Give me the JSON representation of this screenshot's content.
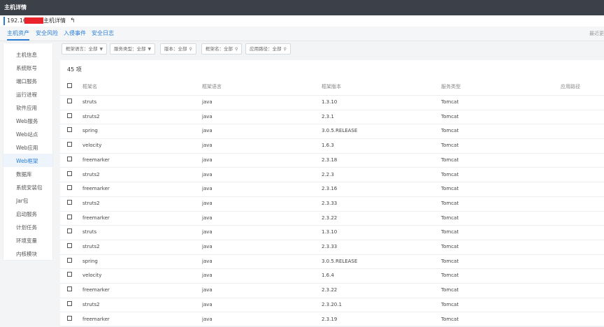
{
  "topbar": {
    "title": "主机详情"
  },
  "subheader": {
    "ip_prefix": "192.168",
    "host_label": "主机详情",
    "back_icon": "↰"
  },
  "tabs": [
    {
      "label": "主机资产",
      "active": true
    },
    {
      "label": "安全风险",
      "active": false
    },
    {
      "label": "入侵事件",
      "active": false
    },
    {
      "label": "安全日志",
      "active": false
    }
  ],
  "tabs_right_note": "最近更",
  "sidebar": {
    "items": [
      {
        "label": "主机信息"
      },
      {
        "label": "系统账号"
      },
      {
        "label": "端口服务"
      },
      {
        "label": "运行进程"
      },
      {
        "label": "软件应用"
      },
      {
        "label": "Web服务"
      },
      {
        "label": "Web站点"
      },
      {
        "label": "Web应用"
      },
      {
        "label": "Web框架",
        "active": true
      },
      {
        "label": "数据库"
      },
      {
        "label": "系统安装包"
      },
      {
        "label": "Jar包"
      },
      {
        "label": "启动服务"
      },
      {
        "label": "计划任务"
      },
      {
        "label": "环境变量"
      },
      {
        "label": "内核模块"
      }
    ]
  },
  "filters": [
    {
      "label": "框架语言：全部",
      "icon": "▼"
    },
    {
      "label": "服务类型：全部",
      "icon": "▼"
    },
    {
      "label": "版本：全部",
      "icon": "⚲"
    },
    {
      "label": "框架名：全部",
      "icon": "⚲"
    },
    {
      "label": "应用路径：全部",
      "icon": "⚲"
    }
  ],
  "table": {
    "count_label": "45 项",
    "headers": [
      "框架名",
      "框架语言",
      "框架版本",
      "服务类型",
      "应用路径"
    ],
    "rows": [
      [
        "struts",
        "java",
        "1.3.10",
        "Tomcat"
      ],
      [
        "struts2",
        "java",
        "2.3.1",
        "Tomcat"
      ],
      [
        "spring",
        "java",
        "3.0.5.RELEASE",
        "Tomcat"
      ],
      [
        "velocity",
        "java",
        "1.6.3",
        "Tomcat"
      ],
      [
        "freemarker",
        "java",
        "2.3.18",
        "Tomcat"
      ],
      [
        "struts2",
        "java",
        "2.2.3",
        "Tomcat"
      ],
      [
        "freemarker",
        "java",
        "2.3.16",
        "Tomcat"
      ],
      [
        "struts2",
        "java",
        "2.3.33",
        "Tomcat"
      ],
      [
        "freemarker",
        "java",
        "2.3.22",
        "Tomcat"
      ],
      [
        "struts",
        "java",
        "1.3.10",
        "Tomcat"
      ],
      [
        "struts2",
        "java",
        "2.3.33",
        "Tomcat"
      ],
      [
        "spring",
        "java",
        "3.0.5.RELEASE",
        "Tomcat"
      ],
      [
        "velocity",
        "java",
        "1.6.4",
        "Tomcat"
      ],
      [
        "freemarker",
        "java",
        "2.3.22",
        "Tomcat"
      ],
      [
        "struts2",
        "java",
        "2.3.20.1",
        "Tomcat"
      ],
      [
        "freemarker",
        "java",
        "2.3.19",
        "Tomcat"
      ]
    ]
  },
  "colors": {
    "accent": "#2a7fd4",
    "topbar": "#3c4048",
    "redaction": "#e8242a"
  }
}
